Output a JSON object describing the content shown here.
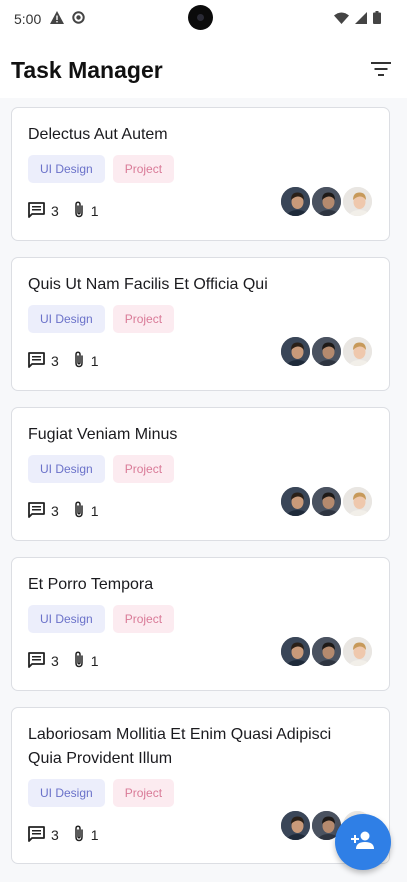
{
  "status_bar": {
    "time": "5:00",
    "left_icons": [
      "warning-icon",
      "data-saver-icon"
    ],
    "right_icons": [
      "wifi-icon",
      "signal-icon",
      "battery-icon"
    ]
  },
  "app_bar": {
    "title": "Task Manager",
    "filter_icon": "filter-list-icon"
  },
  "tasks": [
    {
      "title": "Delectus Aut Autem",
      "tags": [
        "UI Design",
        "Project"
      ],
      "comments": "3",
      "attachments": "1"
    },
    {
      "title": "Quis Ut Nam Facilis Et Officia Qui",
      "tags": [
        "UI Design",
        "Project"
      ],
      "comments": "3",
      "attachments": "1"
    },
    {
      "title": "Fugiat Veniam Minus",
      "tags": [
        "UI Design",
        "Project"
      ],
      "comments": "3",
      "attachments": "1"
    },
    {
      "title": "Et Porro Tempora",
      "tags": [
        "UI Design",
        "Project"
      ],
      "comments": "3",
      "attachments": "1"
    },
    {
      "title": "Laboriosam Mollitia Et Enim Quasi Adipisci Quia Provident Illum",
      "tags": [
        "UI Design",
        "Project"
      ],
      "comments": "3",
      "attachments": "1"
    }
  ],
  "fab": {
    "icon": "person-add-icon"
  },
  "colors": {
    "accent": "#2f7fe6",
    "tag_ui_bg": "#eceefb",
    "tag_ui_text": "#6a71c9",
    "tag_project_bg": "#fcebf0",
    "tag_project_text": "#d97a97",
    "content_bg": "#f7f8fa"
  }
}
